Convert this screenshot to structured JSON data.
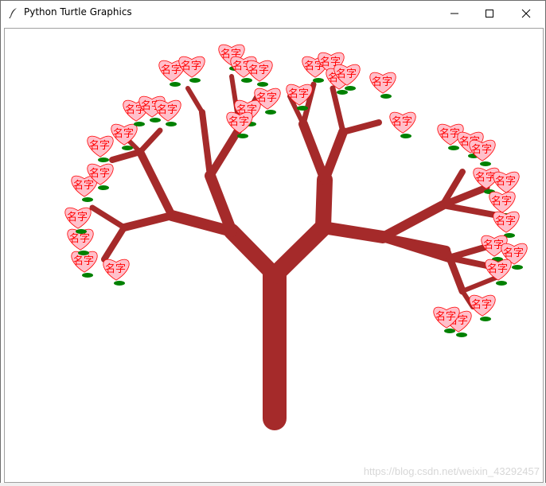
{
  "window": {
    "title": "Python Turtle Graphics",
    "icon": "feather-icon",
    "controls": [
      "minimize-icon",
      "maximize-icon",
      "close-icon"
    ]
  },
  "canvas": {
    "leaf_text": "名字",
    "colors": {
      "trunk": "#a52a2a",
      "leaf": "#008000",
      "blossom_fill": "#ffc0cb",
      "blossom_stroke": "#ff0000",
      "text": "#ff0000"
    }
  },
  "watermark": "https://blog.csdn.net/weixin_43292457"
}
